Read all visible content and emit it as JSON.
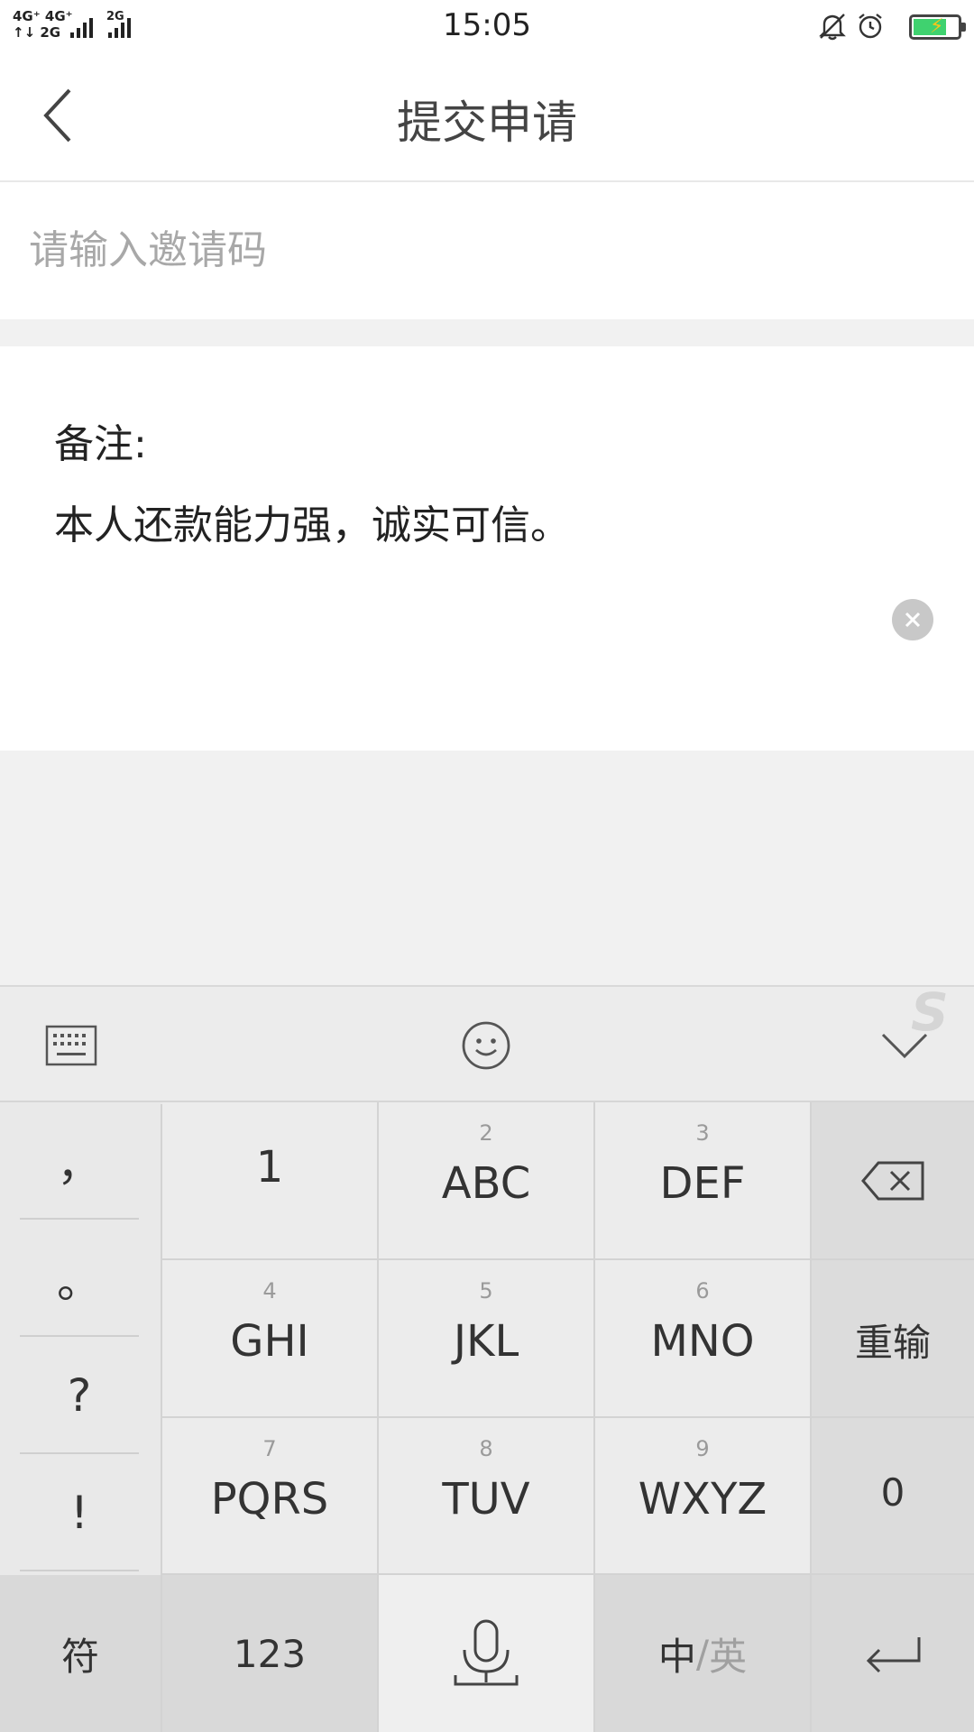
{
  "status_bar": {
    "signal_left_top": "4G⁺ 4G⁺",
    "signal_left_bottom": "↑↓ 2G",
    "signal_right": "2G",
    "time": "15:05",
    "icons": [
      "bell-muted-icon",
      "alarm-icon",
      "battery-charging-icon"
    ]
  },
  "header": {
    "title": "提交申请",
    "back_icon": "chevron-left-icon"
  },
  "invite": {
    "placeholder": "请输入邀请码",
    "value": ""
  },
  "note": {
    "label": "备注:",
    "text": "本人还款能力强，诚实可信。",
    "clear_icon": "clear-circle-icon"
  },
  "keyboard": {
    "toolbar": {
      "left_icon": "keyboard-icon",
      "center_icon": "emoji-icon",
      "right_icon": "collapse-chevron-icon",
      "watermark": "S"
    },
    "punctuation": [
      "，",
      "。",
      "?",
      "!"
    ],
    "keys": [
      {
        "num": "",
        "label": "1"
      },
      {
        "num": "2",
        "label": "ABC"
      },
      {
        "num": "3",
        "label": "DEF"
      },
      {
        "num": "4",
        "label": "GHI"
      },
      {
        "num": "5",
        "label": "JKL"
      },
      {
        "num": "6",
        "label": "MNO"
      },
      {
        "num": "7",
        "label": "PQRS"
      },
      {
        "num": "8",
        "label": "TUV"
      },
      {
        "num": "9",
        "label": "WXYZ"
      }
    ],
    "right_column": {
      "delete_icon": "backspace-icon",
      "reenter": "重输",
      "zero": "0"
    },
    "bottom_row": {
      "symbols": "符",
      "numbers": "123",
      "mic_icon": "microphone-icon",
      "zh": "中",
      "slash": "/",
      "en": "英",
      "enter_icon": "enter-icon"
    }
  }
}
